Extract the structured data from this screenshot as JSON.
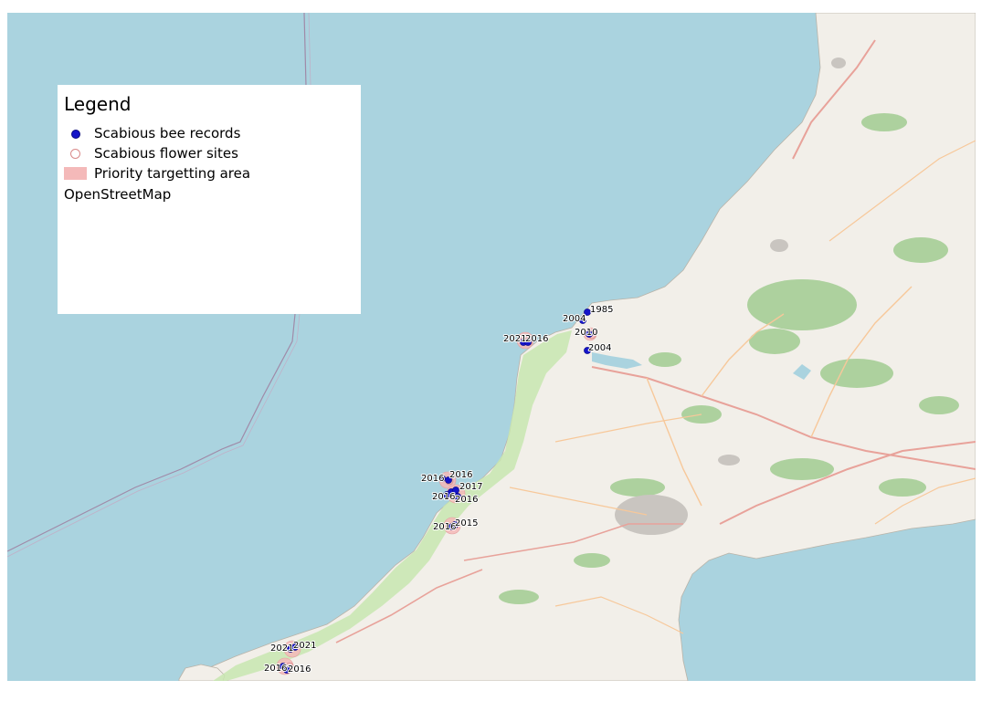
{
  "legend": {
    "title": "Legend",
    "items": [
      {
        "label": "Scabious bee records",
        "symbol": "filled-blue-dot",
        "color": "#1414c8"
      },
      {
        "label": "Scabious flower sites",
        "symbol": "hollow-pink-circle",
        "color": "#d98a8a"
      },
      {
        "label": "Priority targetting area",
        "symbol": "pink-fill-square",
        "color": "#f4b9b9"
      }
    ],
    "basemap_label": "OpenStreetMap"
  },
  "colors": {
    "sea": "#aad3df",
    "land": "#f2efe9",
    "coast_green": "#c8e6b0",
    "woodland": "#add19e",
    "record_dot": "#1414c8",
    "priority_area": "#f4b9b9"
  },
  "records": [
    {
      "year": "1985"
    },
    {
      "year": "2004"
    },
    {
      "year": "2010"
    },
    {
      "year": "2004"
    },
    {
      "year": "2021"
    },
    {
      "year": "2016"
    },
    {
      "year": "2016"
    },
    {
      "year": "2016"
    },
    {
      "year": "2017"
    },
    {
      "year": "2016"
    },
    {
      "year": "2016"
    },
    {
      "year": "2016"
    },
    {
      "year": "2015"
    },
    {
      "year": "2021"
    },
    {
      "year": "2021"
    },
    {
      "year": "2016"
    },
    {
      "year": "2016"
    }
  ]
}
